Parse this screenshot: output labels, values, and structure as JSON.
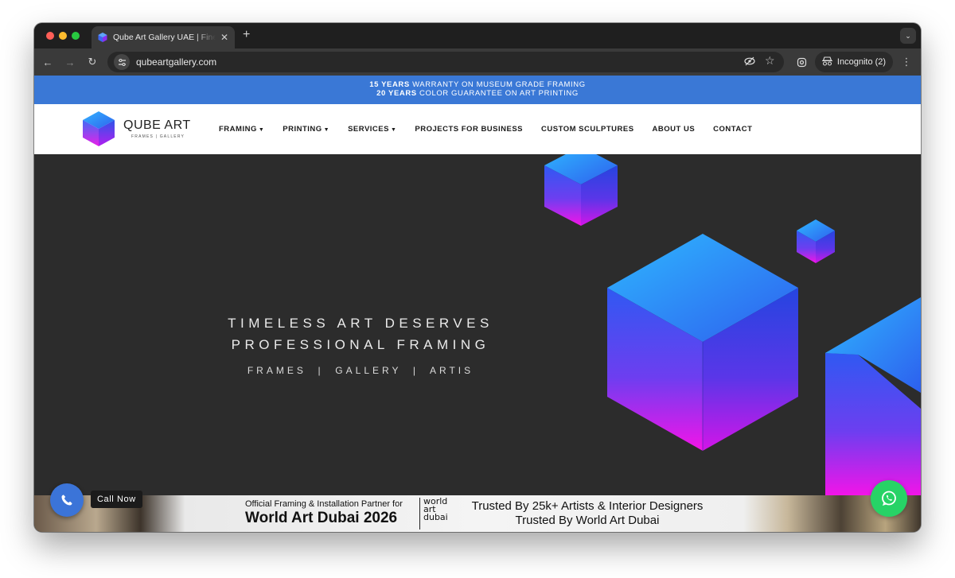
{
  "browser": {
    "tab_title": "Qube Art Gallery UAE | Fine Art Framing",
    "new_tab_icon": "+",
    "url": "qubeartgallery.com",
    "incognito_label": "Incognito (2)"
  },
  "promo": {
    "line1_bold": "15 YEARS",
    "line1_rest": " WARRANTY ON MUSEUM GRADE FRAMING",
    "line2_bold": "20 YEARS",
    "line2_rest": " COLOR GUARANTEE ON ART PRINTING",
    "background_color": "#3a78d6"
  },
  "header": {
    "logo_title": "QUBE ART",
    "logo_subtitle": "FRAMES | GALLERY",
    "nav": [
      {
        "label": "FRAMING",
        "dropdown": true
      },
      {
        "label": "PRINTING",
        "dropdown": true
      },
      {
        "label": "SERVICES",
        "dropdown": true
      },
      {
        "label": "PROJECTS FOR BUSINESS",
        "dropdown": false
      },
      {
        "label": "CUSTOM SCULPTURES",
        "dropdown": false
      },
      {
        "label": "ABOUT US",
        "dropdown": false
      },
      {
        "label": "CONTACT",
        "dropdown": false
      }
    ]
  },
  "hero": {
    "line1": "TIMELESS ART DESERVES",
    "line2": "PROFESSIONAL FRAMING",
    "sub": "FRAMES  |  GALLERY  |  ARTIS",
    "background_color": "#2c2c2c"
  },
  "banner": {
    "partner_text": "Official Framing & Installation Partner for",
    "event_name": "World Art Dubai 2026",
    "logo_text": "world art dubai",
    "trust_line1": "Trusted By 25k+ Artists & Interior Designers",
    "trust_line2": "Trusted By World Art Dubai"
  },
  "floating": {
    "call_label": "Call Now",
    "call_icon": "phone-icon",
    "whatsapp_icon": "whatsapp-icon",
    "call_color": "#3b74d8",
    "whatsapp_color": "#27d366"
  }
}
